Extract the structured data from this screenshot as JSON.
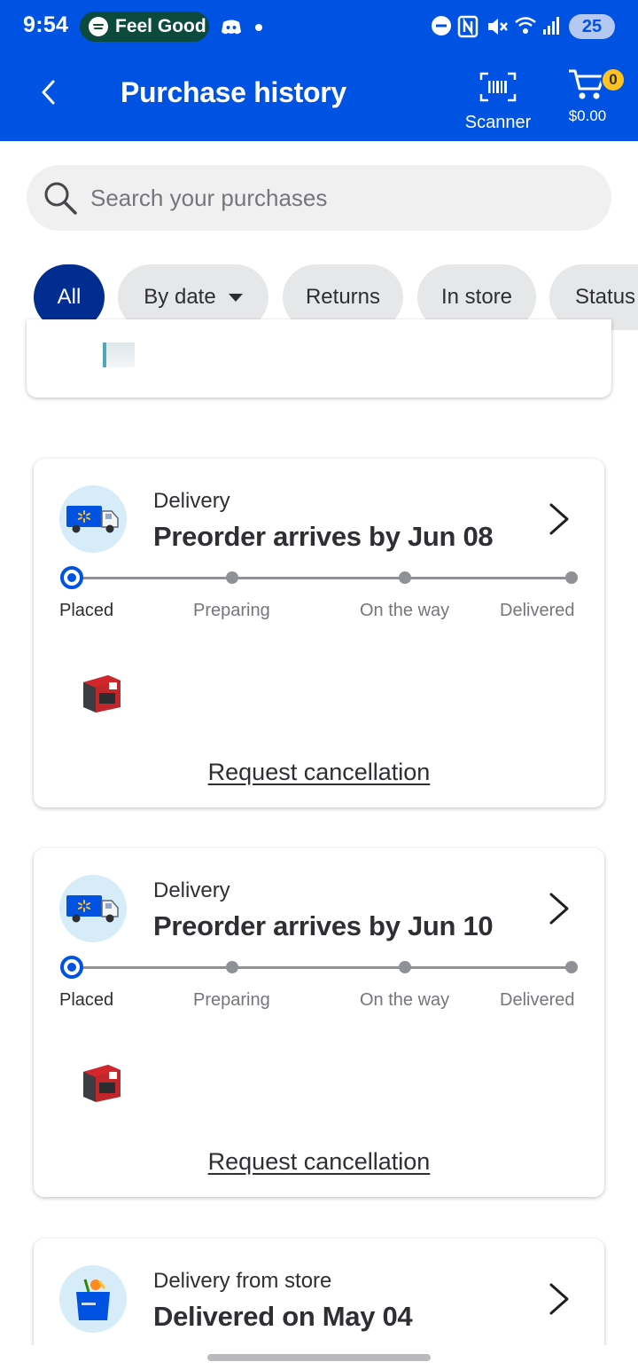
{
  "status_bar": {
    "time": "9:54",
    "media_pill_text": "Feel Good",
    "battery": "25"
  },
  "header": {
    "title": "Purchase history",
    "scanner_label": "Scanner",
    "cart_total": "$0.00",
    "cart_count": "0"
  },
  "search": {
    "placeholder": "Search your purchases",
    "value": ""
  },
  "filters": [
    {
      "label": "All",
      "active": true
    },
    {
      "label": "By date",
      "active": false
    },
    {
      "label": "Returns",
      "active": false
    },
    {
      "label": "In store",
      "active": false
    },
    {
      "label": "Status",
      "active": false
    }
  ],
  "orders": [
    {
      "method": "Delivery",
      "headline": "Preorder arrives by Jun 08",
      "steps": [
        "Placed",
        "Preparing",
        "On the way",
        "Delivered"
      ],
      "current_step": 0,
      "action": "Request cancellation"
    },
    {
      "method": "Delivery",
      "headline": "Preorder arrives by Jun 10",
      "steps": [
        "Placed",
        "Preparing",
        "On the way",
        "Delivered"
      ],
      "current_step": 0,
      "action": "Request cancellation"
    },
    {
      "method": "Delivery from store",
      "headline": "Delivered on May 04"
    }
  ],
  "colors": {
    "brand_blue": "#0053e2",
    "active_chip": "#002d8f",
    "cart_badge": "#ffc220"
  },
  "icons": [
    "back-arrow-icon",
    "barcode-scanner-icon",
    "cart-icon",
    "search-icon",
    "delivery-truck-icon",
    "chevron-right-icon",
    "shopping-bag-icon"
  ]
}
